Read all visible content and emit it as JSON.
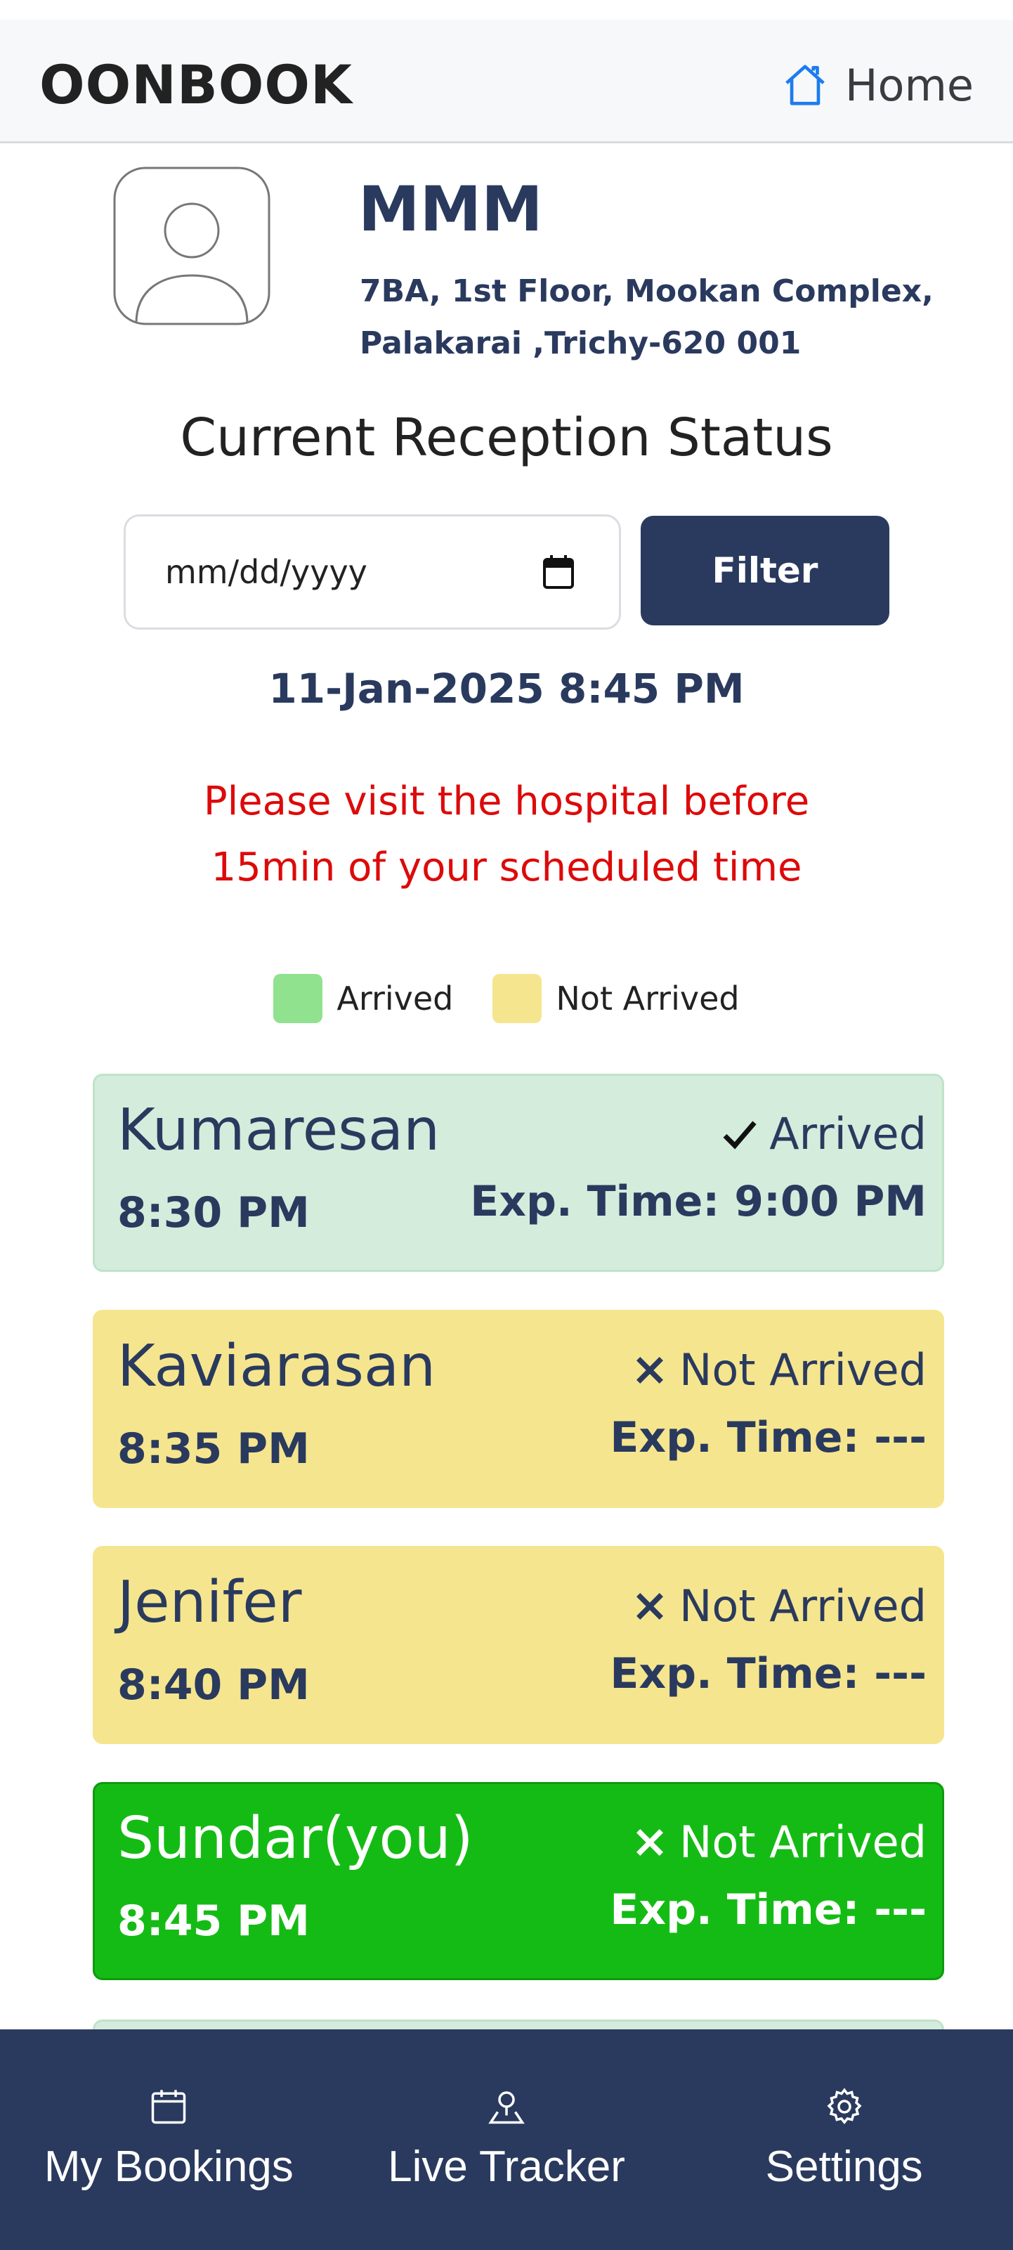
{
  "header": {
    "brand": "OONBOOK",
    "home_label": "Home",
    "home_icon": "home-icon"
  },
  "clinic": {
    "name": "MMM",
    "address_line1": "7BA, 1st Floor, Mookan Complex,",
    "address_line2": "Palakarai ,Trichy-620 001",
    "avatar_icon": "user-avatar-icon"
  },
  "reception": {
    "title": "Current Reception Status",
    "date_placeholder": "mm/dd/yyyy",
    "filter_label": "Filter",
    "datetime": "11-Jan-2025 8:45 PM",
    "notice_line1": "Please visit the hospital before",
    "notice_line2": "15min of your scheduled time"
  },
  "legend": [
    {
      "label": "Arrived",
      "color": "#90e28e"
    },
    {
      "label": "Not Arrived",
      "color": "#f5e58e"
    }
  ],
  "colors": {
    "primary": "#2a3a5e",
    "arrived_bg": "#d4ecdc",
    "not_arrived_bg": "#f5e58e",
    "you_bg": "#15bb15",
    "notice": "#dd0a0a"
  },
  "appointments": [
    {
      "name": "Kumaresan",
      "time": "8:30 PM",
      "status": "Arrived",
      "status_icon": "check-icon",
      "exp_time": "Exp. Time: 9:00 PM"
    },
    {
      "name": "Kaviarasan",
      "time": "8:35 PM",
      "status": "Not Arrived",
      "status_icon": "cross-icon",
      "exp_time": "Exp. Time: ---"
    },
    {
      "name": "Jenifer",
      "time": "8:40 PM",
      "status": "Not Arrived",
      "status_icon": "cross-icon",
      "exp_time": "Exp. Time: ---"
    },
    {
      "name": "Sundar(you)",
      "time": "8:45 PM",
      "status": "Not Arrived",
      "status_icon": "cross-icon",
      "exp_time": "Exp. Time: ---"
    }
  ],
  "bottom_nav": [
    {
      "label": "My Bookings",
      "icon": "calendar-icon"
    },
    {
      "label": "Live Tracker",
      "icon": "map-pin-icon"
    },
    {
      "label": "Settings",
      "icon": "gear-icon"
    }
  ]
}
